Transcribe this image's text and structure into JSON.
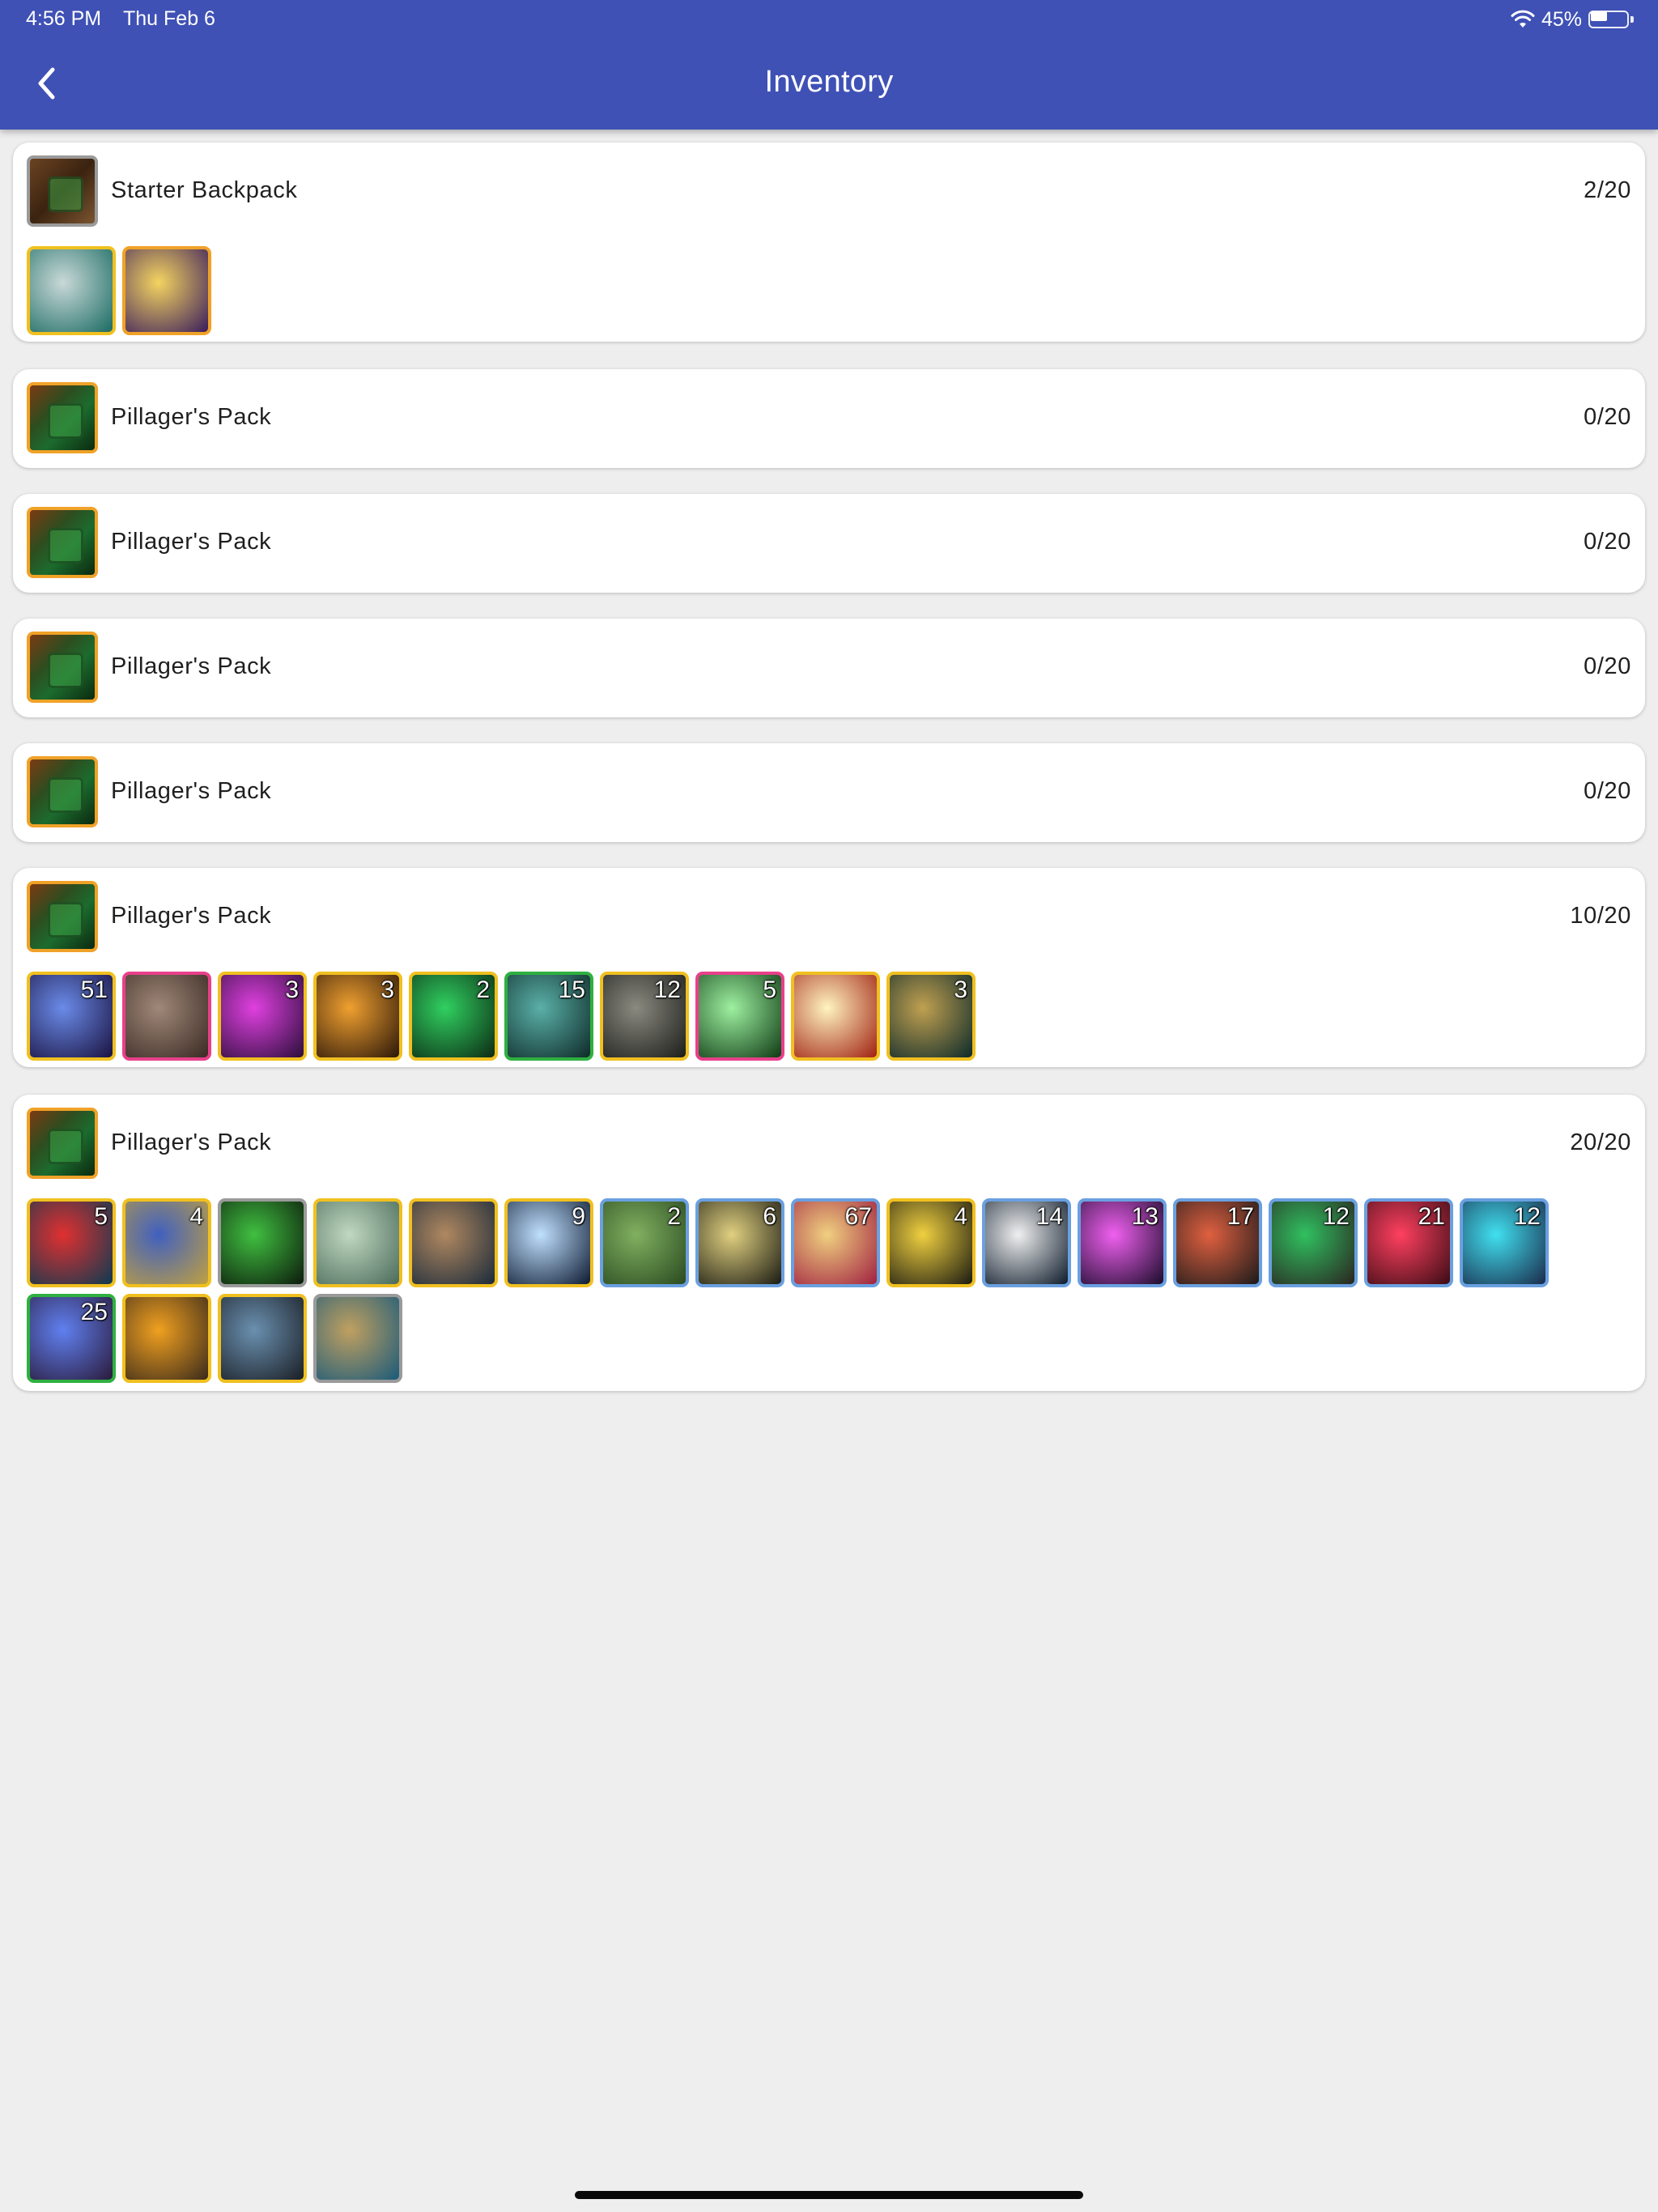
{
  "status": {
    "time": "4:56 PM",
    "date": "Thu Feb 6",
    "battery": "45%",
    "battery_level": 0.45
  },
  "header": {
    "title": "Inventory"
  },
  "bags": [
    {
      "name": "Starter Backpack",
      "count": "2/20",
      "icon": "backpack-icon",
      "border": "#9a9a9a",
      "items": [
        {
          "icon": "shirt-icon",
          "qty": "",
          "border": "#f0c020",
          "c1": "#c9d9d8",
          "c2": "#1b6b63"
        },
        {
          "icon": "spark-scroll-icon",
          "qty": "",
          "border": "#f0a228",
          "c1": "#f4d460",
          "c2": "#3a1c5c"
        }
      ]
    },
    {
      "name": "Pillager's Pack",
      "count": "0/20",
      "icon": "pack-icon",
      "border": "#f0a228",
      "items": []
    },
    {
      "name": "Pillager's Pack",
      "count": "0/20",
      "icon": "pack-icon",
      "border": "#f0a228",
      "items": []
    },
    {
      "name": "Pillager's Pack",
      "count": "0/20",
      "icon": "pack-icon",
      "border": "#f0a228",
      "items": []
    },
    {
      "name": "Pillager's Pack",
      "count": "0/20",
      "icon": "pack-icon",
      "border": "#f0a228",
      "items": []
    },
    {
      "name": "Pillager's Pack",
      "count": "10/20",
      "icon": "pack-icon",
      "border": "#f0a228",
      "items": [
        {
          "icon": "blue-swirl-icon",
          "qty": "51",
          "border": "#f0c020",
          "c1": "#6a8be8",
          "c2": "#1a1240"
        },
        {
          "icon": "hammer-icon",
          "qty": "",
          "border": "#e8408a",
          "c1": "#a08878",
          "c2": "#3a2a24"
        },
        {
          "icon": "purple-potion-icon",
          "qty": "3",
          "border": "#f0c020",
          "c1": "#e040e0",
          "c2": "#2a0e3a"
        },
        {
          "icon": "orange-potion-icon",
          "qty": "3",
          "border": "#f0c020",
          "c1": "#f0a030",
          "c2": "#2a1608"
        },
        {
          "icon": "green-potion-icon",
          "qty": "2",
          "border": "#f0c020",
          "c1": "#30d060",
          "c2": "#0c2a14"
        },
        {
          "icon": "crate-icon",
          "qty": "15",
          "border": "#2fb040",
          "c1": "#5ab0a8",
          "c2": "#0e2a28"
        },
        {
          "icon": "chest-icon",
          "qty": "12",
          "border": "#f0c020",
          "c1": "#8a8a80",
          "c2": "#1c1c1a"
        },
        {
          "icon": "green-crystal-icon",
          "qty": "5",
          "border": "#e8408a",
          "c1": "#9ef0a0",
          "c2": "#0e3a14"
        },
        {
          "icon": "starburst-icon",
          "qty": "",
          "border": "#f0c020",
          "c1": "#fff4c0",
          "c2": "#a02010"
        },
        {
          "icon": "tool-icon",
          "qty": "3",
          "border": "#f0c020",
          "c1": "#c0a050",
          "c2": "#0c2a2a"
        }
      ]
    },
    {
      "name": "Pillager's Pack",
      "count": "20/20",
      "icon": "pack-icon",
      "border": "#f0a228",
      "items": [
        {
          "icon": "banner-red-icon",
          "qty": "5",
          "border": "#f0c020",
          "c1": "#e03030",
          "c2": "#0c3a50"
        },
        {
          "icon": "banner-blue-icon",
          "qty": "4",
          "border": "#f0c020",
          "c1": "#4060c0",
          "c2": "#c0a040"
        },
        {
          "icon": "moss-icon",
          "qty": "",
          "border": "#9a9a9a",
          "c1": "#40c040",
          "c2": "#0c1a0c"
        },
        {
          "icon": "map-scroll-icon",
          "qty": "",
          "border": "#f0c020",
          "c1": "#c0d8c0",
          "c2": "#4a6a5a"
        },
        {
          "icon": "tome-icon",
          "qty": "",
          "border": "#f0c020",
          "c1": "#b08860",
          "c2": "#1a2a3a"
        },
        {
          "icon": "ice-shard-icon",
          "qty": "9",
          "border": "#f0c020",
          "c1": "#c0e0ff",
          "c2": "#0c1a30"
        },
        {
          "icon": "terrain-icon",
          "qty": "2",
          "border": "#6aa0e0",
          "c1": "#80b060",
          "c2": "#2a4a20"
        },
        {
          "icon": "anvil-icon",
          "qty": "6",
          "border": "#6aa0e0",
          "c1": "#e0d080",
          "c2": "#1a1a12"
        },
        {
          "icon": "cake-icon",
          "qty": "67",
          "border": "#6aa0e0",
          "c1": "#f0d080",
          "c2": "#a02040"
        },
        {
          "icon": "xp-boost-icon",
          "qty": "4",
          "border": "#f0c020",
          "c1": "#f0d040",
          "c2": "#1a1a10"
        },
        {
          "icon": "winged-trophy-icon",
          "qty": "14",
          "border": "#6aa0e0",
          "c1": "#f0f0f0",
          "c2": "#0c1a2a"
        },
        {
          "icon": "magic-wand-icon",
          "qty": "13",
          "border": "#6aa0e0",
          "c1": "#f060f0",
          "c2": "#1a0c2a"
        },
        {
          "icon": "canister-icon",
          "qty": "17",
          "border": "#6aa0e0",
          "c1": "#e06040",
          "c2": "#1a1a1a"
        },
        {
          "icon": "upgrade-crate-icon",
          "qty": "12",
          "border": "#6aa0e0",
          "c1": "#30c060",
          "c2": "#2a2420"
        },
        {
          "icon": "ruby-orb-icon",
          "qty": "21",
          "border": "#6aa0e0",
          "c1": "#ff4060",
          "c2": "#3a0c14"
        },
        {
          "icon": "gem-frame-icon",
          "qty": "12",
          "border": "#6aa0e0",
          "c1": "#40e0f0",
          "c2": "#1a2a4a"
        },
        {
          "icon": "gift-upgrade-icon",
          "qty": "25",
          "border": "#2fb040",
          "c1": "#6080f0",
          "c2": "#2a1a3a"
        },
        {
          "icon": "pumpkin-envelope-icon",
          "qty": "",
          "border": "#f0c020",
          "c1": "#f0a020",
          "c2": "#3a2a1a"
        },
        {
          "icon": "armored-chest-icon",
          "qty": "",
          "border": "#f0c020",
          "c1": "#6a90b0",
          "c2": "#1a1e24"
        },
        {
          "icon": "robot-icon",
          "qty": "",
          "border": "#9a9a9a",
          "c1": "#c0a060",
          "c2": "#1a5a7a"
        }
      ]
    }
  ]
}
